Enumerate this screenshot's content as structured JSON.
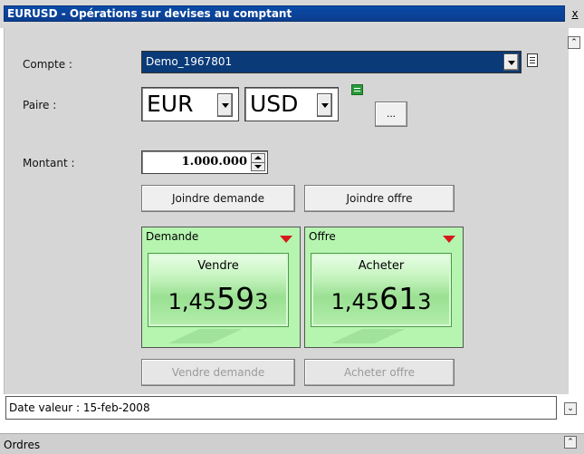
{
  "window": {
    "title": "EURUSD - Opérations sur devises au comptant",
    "close_glyph": "x",
    "collapse_glyph": "⌃"
  },
  "form": {
    "account_label": "Compte :",
    "account_value": "Demo_1967801",
    "pair_label": "Paire :",
    "base_currency": "EUR",
    "quote_currency": "USD",
    "more_label": "...",
    "amount_label": "Montant :",
    "amount_value": "1.000.000"
  },
  "buttons": {
    "join_bid": "Joindre demande",
    "join_offer": "Joindre offre",
    "sell_bid": "Vendre demande",
    "buy_offer": "Acheter offre"
  },
  "quotes": {
    "bid": {
      "header": "Demande",
      "action": "Vendre",
      "price_prefix": "1,45",
      "price_big": "59",
      "price_suffix": "3"
    },
    "offer": {
      "header": "Offre",
      "action": "Acheter",
      "price_prefix": "1,45",
      "price_big": "61",
      "price_suffix": "3"
    }
  },
  "footer": {
    "value_date": "Date valeur : 15-feb-2008",
    "expand_glyph": "⌄",
    "orders_label": "Ordres"
  },
  "colors": {
    "title_bar": "#0b3e8f",
    "quote_background": "#b6f5b0",
    "arrow_red": "#d61a1a"
  }
}
